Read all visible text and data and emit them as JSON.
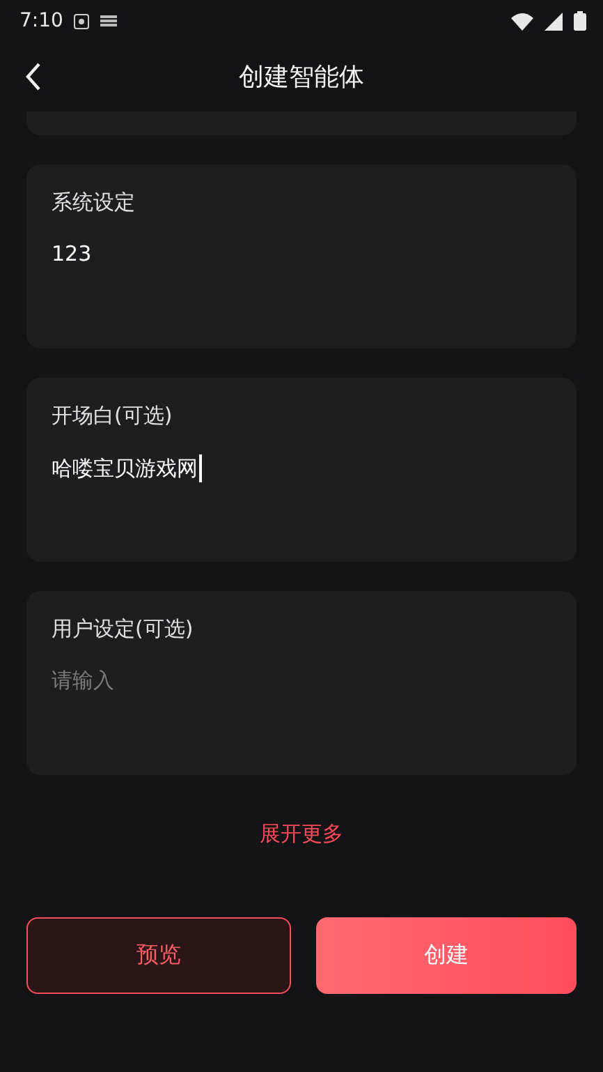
{
  "status_bar": {
    "time": "7:10"
  },
  "header": {
    "title": "创建智能体"
  },
  "fields": [
    {
      "label": "系统设定",
      "value": "123",
      "focused": false
    },
    {
      "label": "开场白(可选)",
      "value": "哈喽宝贝游戏网",
      "focused": true
    },
    {
      "label": "用户设定(可选)",
      "placeholder": "请输入",
      "focused": false
    }
  ],
  "expand_link": "展开更多",
  "buttons": [
    {
      "label": "预览",
      "kind": "secondary"
    },
    {
      "label": "创建",
      "kind": "primary"
    }
  ]
}
